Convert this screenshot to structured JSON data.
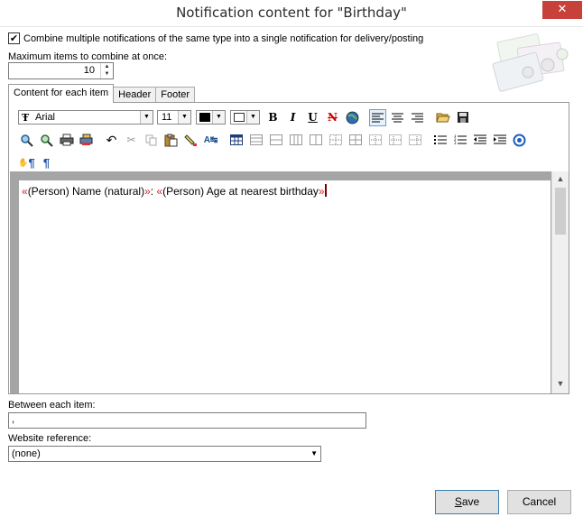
{
  "window": {
    "title": "Notification content for \"Birthday\"",
    "close_glyph": "✕"
  },
  "combine": {
    "checked": true,
    "check_glyph": "✔",
    "label": "Combine multiple notifications of the same type into a single notification for delivery/posting"
  },
  "max_items": {
    "label": "Maximum items to combine at once:",
    "value": "10"
  },
  "tabs": [
    {
      "label": "Content for each item",
      "active": true
    },
    {
      "label": "Header",
      "active": false
    },
    {
      "label": "Footer",
      "active": false
    }
  ],
  "toolbar": {
    "font_name": "Arial",
    "font_size": "11",
    "text_color": "#000000",
    "bg_color": "#ffffff",
    "bold": "B",
    "italic": "I",
    "underline": "U",
    "strike": "N",
    "pilcrow": "¶"
  },
  "editor": {
    "fields": [
      {
        "open": "«",
        "text": "(Person) Name (natural)",
        "close": "»"
      },
      {
        "separator": ": "
      },
      {
        "open": "«",
        "text": "(Person) Age at nearest birthday",
        "close": "»"
      }
    ]
  },
  "between": {
    "label": "Between each item:",
    "value": ","
  },
  "website": {
    "label": "Website reference:",
    "value": "(none)"
  },
  "buttons": {
    "save_prefix": "",
    "save_u": "S",
    "save_rest": "ave",
    "cancel": "Cancel"
  }
}
